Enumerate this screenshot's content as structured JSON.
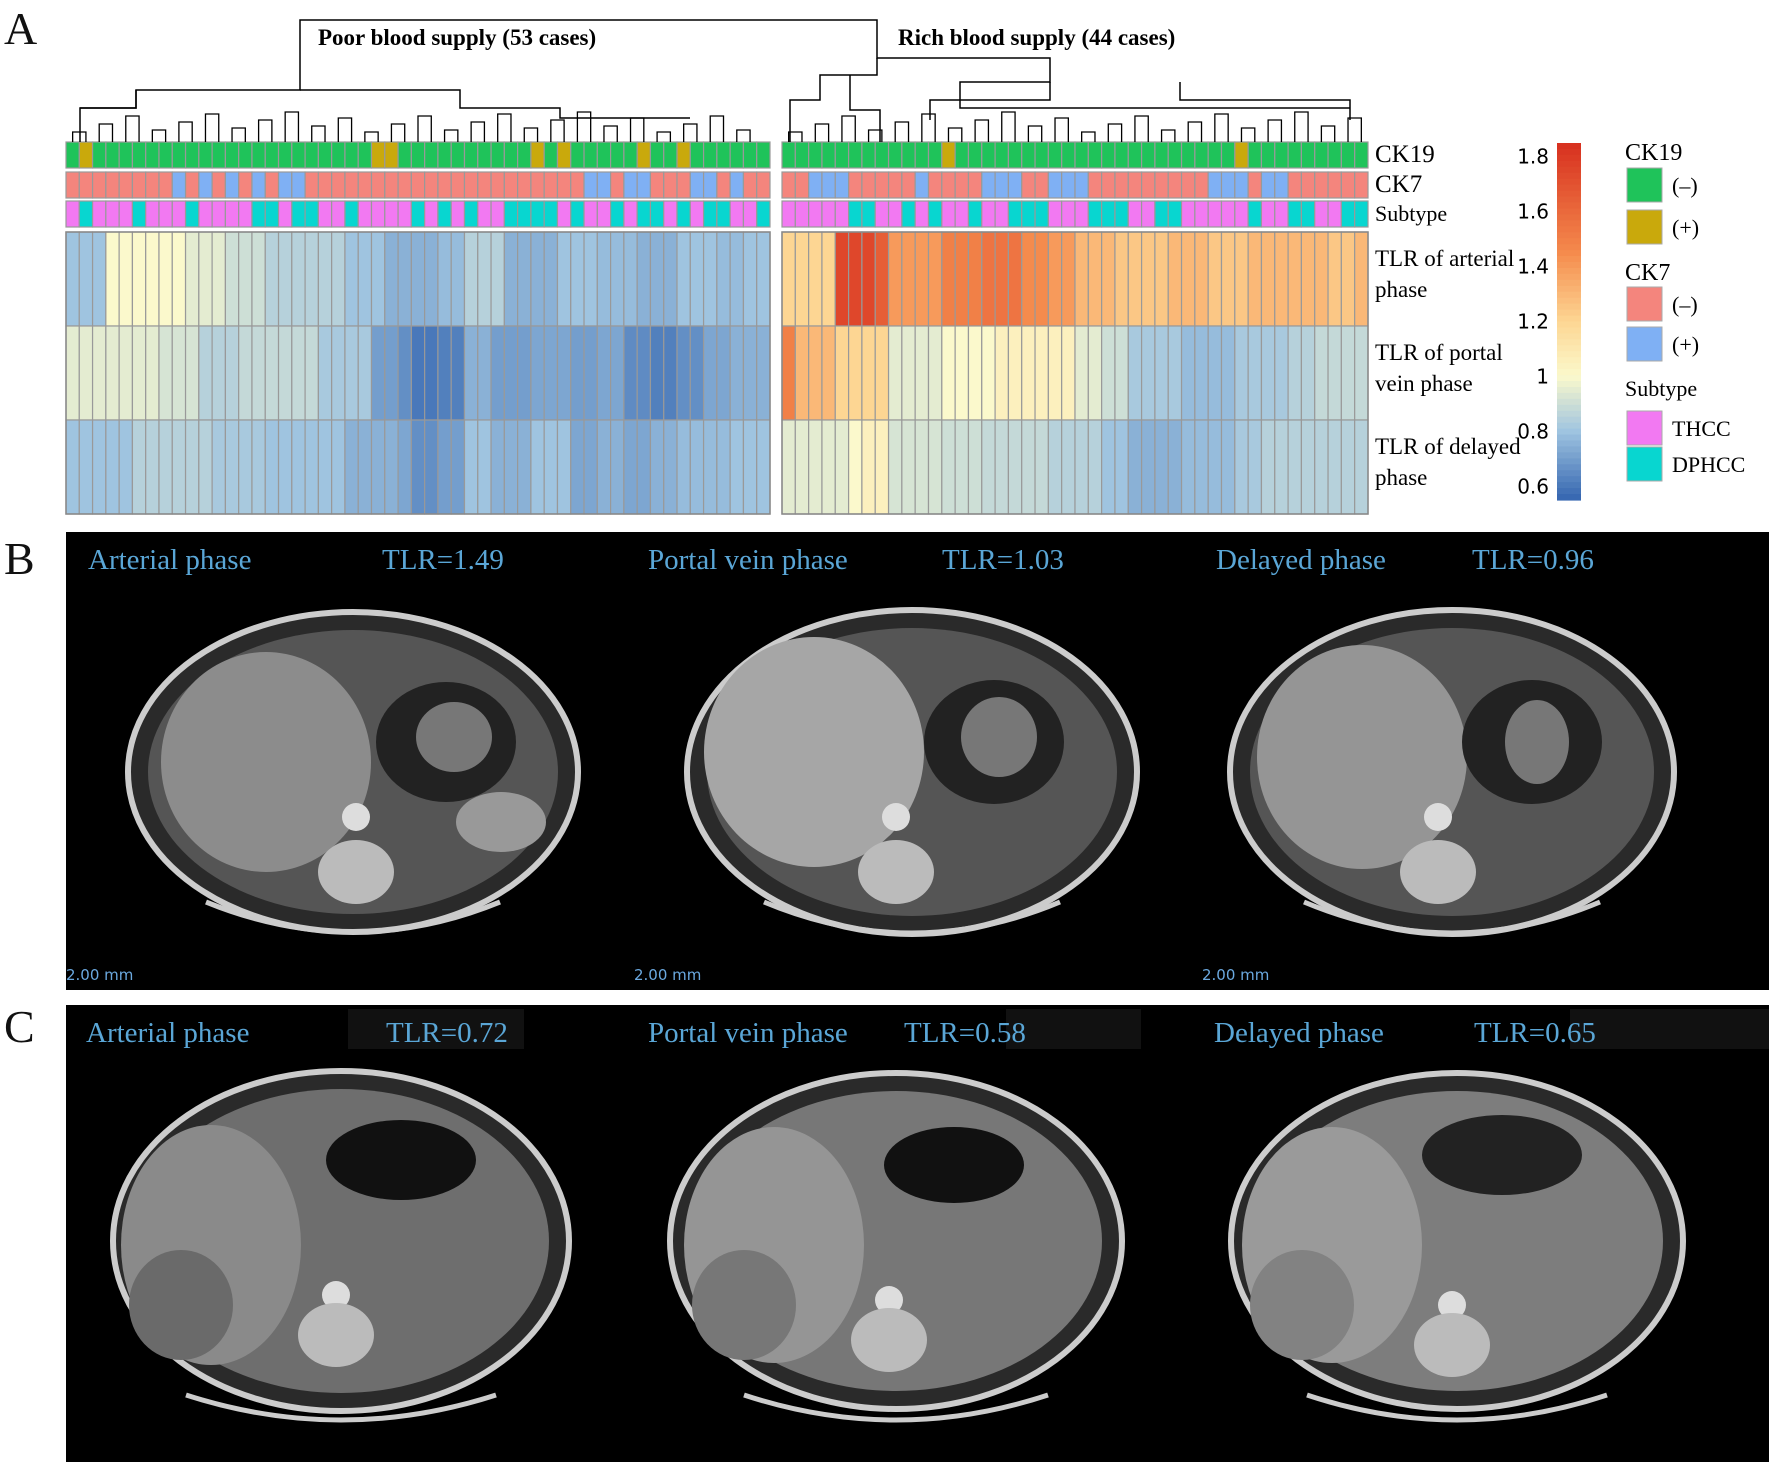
{
  "panels": {
    "a": "A",
    "b": "B",
    "c": "C"
  },
  "chart_data": {
    "type": "heatmap",
    "groups": [
      {
        "label": "Poor blood supply (53 cases)",
        "n": 53
      },
      {
        "label": "Rich blood supply (44 cases)",
        "n": 44
      }
    ],
    "annotation_rows": [
      "CK19",
      "CK7",
      "Subtype"
    ],
    "rows": [
      "TLR of arterial phase",
      "TLR of portal vein phase",
      "TLR of delayed phase"
    ],
    "values": {
      "poor": [
        [
          0.8,
          0.8,
          0.8,
          1.0,
          1.0,
          1.0,
          1.0,
          1.0,
          1.0,
          0.95,
          0.95,
          0.95,
          0.9,
          0.9,
          0.9,
          0.85,
          0.85,
          0.85,
          0.85,
          0.85,
          0.85,
          0.8,
          0.8,
          0.8,
          0.75,
          0.75,
          0.75,
          0.75,
          0.78,
          0.78,
          0.85,
          0.85,
          0.85,
          0.75,
          0.75,
          0.75,
          0.75,
          0.8,
          0.8,
          0.8,
          0.78,
          0.78,
          0.78,
          0.75,
          0.75,
          0.75,
          0.8,
          0.8,
          0.8,
          0.78,
          0.78,
          0.8,
          0.8
        ],
        [
          0.95,
          0.95,
          0.95,
          0.95,
          0.95,
          0.95,
          0.95,
          0.92,
          0.92,
          0.92,
          0.85,
          0.85,
          0.85,
          0.88,
          0.88,
          0.88,
          0.88,
          0.88,
          0.88,
          0.82,
          0.82,
          0.82,
          0.82,
          0.7,
          0.7,
          0.66,
          0.6,
          0.6,
          0.62,
          0.62,
          0.75,
          0.75,
          0.7,
          0.7,
          0.7,
          0.72,
          0.72,
          0.72,
          0.7,
          0.7,
          0.72,
          0.72,
          0.65,
          0.65,
          0.62,
          0.62,
          0.66,
          0.66,
          0.72,
          0.72,
          0.75,
          0.75,
          0.75
        ],
        [
          0.8,
          0.8,
          0.8,
          0.8,
          0.8,
          0.85,
          0.85,
          0.85,
          0.85,
          0.85,
          0.85,
          0.82,
          0.82,
          0.82,
          0.82,
          0.8,
          0.8,
          0.8,
          0.8,
          0.8,
          0.8,
          0.75,
          0.75,
          0.75,
          0.75,
          0.72,
          0.66,
          0.66,
          0.7,
          0.7,
          0.8,
          0.8,
          0.75,
          0.75,
          0.75,
          0.8,
          0.8,
          0.8,
          0.72,
          0.72,
          0.75,
          0.75,
          0.72,
          0.72,
          0.75,
          0.75,
          0.78,
          0.78,
          0.78,
          0.78,
          0.8,
          0.8,
          0.8
        ]
      ],
      "rich": [
        [
          1.2,
          1.2,
          1.2,
          1.2,
          1.75,
          1.75,
          1.75,
          1.65,
          1.4,
          1.4,
          1.4,
          1.4,
          1.5,
          1.5,
          1.5,
          1.55,
          1.55,
          1.55,
          1.45,
          1.45,
          1.4,
          1.4,
          1.3,
          1.3,
          1.3,
          1.25,
          1.25,
          1.25,
          1.25,
          1.3,
          1.3,
          1.3,
          1.25,
          1.25,
          1.25,
          1.3,
          1.3,
          1.3,
          1.3,
          1.3,
          1.3,
          1.25,
          1.25,
          1.3
        ],
        [
          1.5,
          1.3,
          1.3,
          1.3,
          1.2,
          1.2,
          1.2,
          1.2,
          0.95,
          0.95,
          0.95,
          0.95,
          1.0,
          1.0,
          1.0,
          1.0,
          1.05,
          1.05,
          1.05,
          1.05,
          1.05,
          1.05,
          0.95,
          0.95,
          0.9,
          0.9,
          0.82,
          0.82,
          0.82,
          0.82,
          0.78,
          0.78,
          0.78,
          0.78,
          0.82,
          0.82,
          0.82,
          0.82,
          0.85,
          0.85,
          0.88,
          0.88,
          0.88,
          0.88
        ],
        [
          0.95,
          0.95,
          0.95,
          0.95,
          0.95,
          1.0,
          1.05,
          1.05,
          0.92,
          0.92,
          0.92,
          0.92,
          0.9,
          0.9,
          0.9,
          0.88,
          0.88,
          0.88,
          0.88,
          0.88,
          0.85,
          0.85,
          0.85,
          0.85,
          0.8,
          0.8,
          0.75,
          0.75,
          0.75,
          0.75,
          0.78,
          0.78,
          0.78,
          0.78,
          0.82,
          0.82,
          0.85,
          0.85,
          0.85,
          0.85,
          0.85,
          0.85,
          0.85,
          0.85
        ]
      ]
    },
    "annotations": {
      "poor": {
        "CK19": "0100000000000000000000011000000000010100000100100000",
        "CK7": "00000000101010101100000000000000000000011011000110100",
        "Subtype": "01000100010000110110010000101010011110100101101011001"
      },
      "rich": {
        "CK19": "00000000000010000000000000000000001000000000",
        "CK7": "00111000001000011100111000000000111011000000",
        "Subtype": "00000110010100100111000111001100000100110011"
      }
    },
    "colorbar": {
      "ticks": [
        "1.8",
        "1.6",
        "1.4",
        "1.2",
        "1",
        "0.8",
        "0.6"
      ],
      "range": [
        0.55,
        1.85
      ]
    },
    "legend": {
      "CK19": {
        "title": "CK19",
        "items": [
          {
            "label": "(–)",
            "color": "#1fc35a"
          },
          {
            "label": "(+)",
            "color": "#c9a90c"
          }
        ]
      },
      "CK7": {
        "title": "CK7",
        "items": [
          {
            "label": "(–)",
            "color": "#f4857d"
          },
          {
            "label": "(+)",
            "color": "#7fb0f4"
          }
        ]
      },
      "Subtype": {
        "title": "Subtype",
        "items": [
          {
            "label": "THCC",
            "color": "#f279f2"
          },
          {
            "label": "DPHCC",
            "color": "#08d6d0"
          }
        ]
      }
    },
    "colors": {
      "low": "#3465b0",
      "mid": "#fbf9cc",
      "high": "#d7301f"
    }
  },
  "panel_b": {
    "scans": [
      {
        "phase": "Arterial phase",
        "tlr": "TLR=1.49",
        "scale": "2.00 mm"
      },
      {
        "phase": "Portal vein phase",
        "tlr": "TLR=1.03",
        "scale": "2.00 mm"
      },
      {
        "phase": "Delayed phase",
        "tlr": "TLR=0.96",
        "scale": "2.00 mm"
      }
    ]
  },
  "panel_c": {
    "scans": [
      {
        "phase": "Arterial phase",
        "tlr": "TLR=0.72"
      },
      {
        "phase": "Portal vein phase",
        "tlr": "TLR=0.58"
      },
      {
        "phase": "Delayed phase",
        "tlr": "TLR=0.65"
      }
    ]
  }
}
